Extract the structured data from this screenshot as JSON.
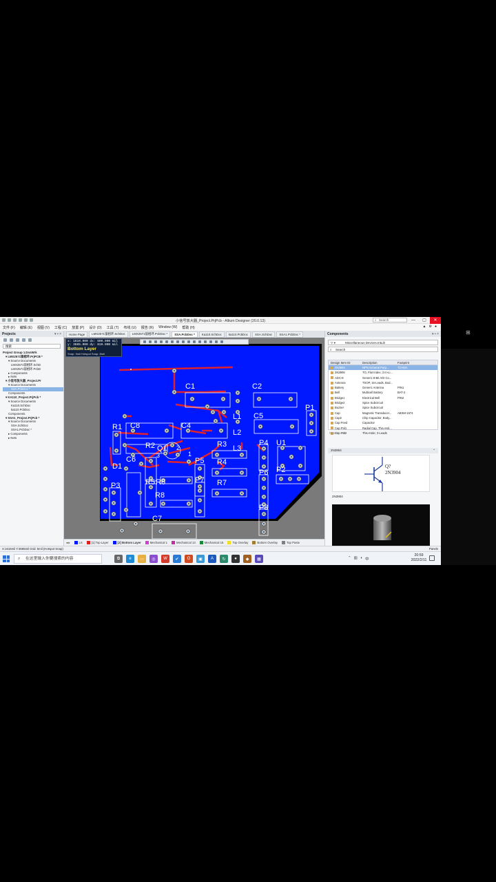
{
  "window": {
    "title": "小信号放大器_Project.PrjPcb - Altium Designer (20.0.13)",
    "search_placeholder": "Search",
    "min": "—",
    "max": "▢",
    "close": "✕"
  },
  "menu": {
    "items": [
      "文件 (F)",
      "编辑 (E)",
      "视图 (V)",
      "工程 (C)",
      "放置 (P)",
      "设计 (D)",
      "工具 (T)",
      "布线 (U)",
      "报告 (R)",
      "Window (W)",
      "帮助 (H)"
    ]
  },
  "projects_panel": {
    "title": "Projects",
    "controls": "▾ ▪ ×",
    "search": "搜索",
    "tree": [
      {
        "text": "Project Group 1.DsnWrk",
        "bold": true,
        "indent": 0
      },
      {
        "text": "▾ LMX2571锁相环.PrjPCB *",
        "bold": true,
        "indent": 1
      },
      {
        "text": "▾ Source Documents",
        "indent": 2
      },
      {
        "text": "LMX2571锁相环.SchD",
        "indent": 3
      },
      {
        "text": "LMX2571锁相环.PcbD",
        "indent": 3
      },
      {
        "text": "▸ Components",
        "indent": 2
      },
      {
        "text": "▸ Nets",
        "indent": 2
      },
      {
        "text": "▾ 小信号放大器_Project.Pr",
        "bold": true,
        "indent": 1
      },
      {
        "text": "▾ Source Documents",
        "indent": 2
      },
      {
        "text": "SSA.PcbDoc *",
        "indent": 3,
        "selected": true
      },
      {
        "text": "Components",
        "indent": 2
      },
      {
        "text": "▾ KA110_Project.PrjPcb *",
        "bold": true,
        "indent": 1
      },
      {
        "text": "▾ Source Documents",
        "indent": 2
      },
      {
        "text": "Ka110.SchDoc",
        "indent": 3
      },
      {
        "text": "ka110.PcbDoc",
        "indent": 3
      },
      {
        "text": "Components",
        "indent": 2
      },
      {
        "text": "▾ SSA1_Project.PrjPcb *",
        "bold": true,
        "indent": 1
      },
      {
        "text": "▾ Source Documents",
        "indent": 2
      },
      {
        "text": "SSA.SchDoc",
        "indent": 3
      },
      {
        "text": "SSA1.PcbDoc *",
        "indent": 3
      },
      {
        "text": "▸ Components",
        "indent": 2
      },
      {
        "text": "▸ Nets",
        "indent": 2
      }
    ]
  },
  "doc_tabs": [
    "Home Page",
    "LMX2571锁相环.SchDoc",
    "LMX2571锁相环.PcbDoc *",
    "SSA.PcbDoc *",
    "Ka110.SchDoc",
    "ka110.PcbDoc",
    "SSA.SchDoc",
    "SSA1.PcbDoc *"
  ],
  "active_tab": 3,
  "hud": {
    "line1": "x: 1610.000  dx:  600.000 mil",
    "line2": "y: 3685.000  dy:  810.000 mil",
    "layer": "Bottom Layer",
    "snap": "Snap: 5mil Hotspot Snap: 8mil"
  },
  "pcb_labels": [
    "C1",
    "C2",
    "L1",
    "C5",
    "P1",
    "R1",
    "C8",
    "C4",
    "L2",
    "L3",
    "U1",
    "R2",
    "Q1",
    "2",
    "3",
    "1",
    "C6",
    "P4",
    "D1",
    "R3",
    "P5",
    "R4",
    "P2",
    "P6",
    "R5",
    "R6",
    "P3",
    "R7",
    "P7",
    "R8",
    "P8",
    "C7"
  ],
  "layer_tabs": [
    {
      "name": "LS",
      "color": "#0018ff"
    },
    {
      "name": "[1] Top Layer",
      "color": "#e02020"
    },
    {
      "name": "[2] Bottom Layer",
      "color": "#0018ff",
      "active": true
    },
    {
      "name": "Mechanical 1",
      "color": "#d040d0"
    },
    {
      "name": "Mechanical 13",
      "color": "#c030a0"
    },
    {
      "name": "Mechanical 15",
      "color": "#1a8a3a"
    },
    {
      "name": "Top Overlay",
      "color": "#f0e020"
    },
    {
      "name": "Bottom Overlay",
      "color": "#a08030"
    },
    {
      "name": "Top Paste",
      "color": "#808080"
    }
  ],
  "components_panel": {
    "title": "Components",
    "library": "Miscellaneous Devices.IntLib",
    "search_placeholder": "Search",
    "columns": [
      "Design Item ID",
      "Description",
      "Footprint"
    ],
    "rows": [
      [
        "2N3904",
        "NPN General Purp...",
        "TO-92A"
      ],
      [
        "2N3906",
        "TO, Flat Index; 3 In-Li...",
        ""
      ],
      [
        "ADC-8",
        "Generic 8-Bit A/D Co...",
        ""
      ],
      [
        "Antenna",
        "TSOP, 16-Leads, Bod...",
        ""
      ],
      [
        "Battery",
        "Generic Antenna",
        "PIN1"
      ],
      [
        "Bell",
        "Multicell Battery",
        "BAT-2"
      ],
      [
        "Bridge1",
        "Electrical Bell",
        "PIN2"
      ],
      [
        "Bridge2",
        "Spice Subcircuit",
        ""
      ],
      [
        "Buzzer",
        "Spice Subcircuit",
        ""
      ],
      [
        "Cap",
        "Magnetic Transducer...",
        "ABSM-1574"
      ],
      [
        "Cap2",
        "Chip Capacitor, Body...",
        ""
      ],
      [
        "Cap Feed",
        "Capacitor",
        ""
      ],
      [
        "Cap Pol1",
        "Radial Cap, Thru-Hol...",
        ""
      ],
      [
        "Cap Pol2",
        "Thru-Hole; 3 Leads",
        ""
      ]
    ],
    "selected_row": 0,
    "results": "Results: 195",
    "selected_name": "2N3904",
    "symbol_designator": "Q?",
    "symbol_value": "2N3904",
    "label_2d": "2N3904"
  },
  "status": {
    "left": "X:1615mil Y:3685mil   Grid: 5mil     (Hotspot Snap)",
    "right": "Panels"
  },
  "taskbar": {
    "search_placeholder": "在这里输入你要搜索的内容",
    "time": "20:59",
    "date": "2022/2/11",
    "ime": "中",
    "apps": [
      {
        "icon": "task-view-icon",
        "color": "#666666",
        "glyph": "⧉"
      },
      {
        "icon": "edge-icon",
        "color": "#1c8ad4",
        "glyph": "e"
      },
      {
        "icon": "folder-icon",
        "color": "#e8b040",
        "glyph": "▭"
      },
      {
        "icon": "app-icon",
        "color": "#8a4fd0",
        "glyph": "◎"
      },
      {
        "icon": "wps-icon",
        "color": "#d23b2b",
        "glyph": "W"
      },
      {
        "icon": "check-icon",
        "color": "#2a7ad8",
        "glyph": "✔"
      },
      {
        "icon": "office-icon",
        "color": "#d04a20",
        "glyph": "O"
      },
      {
        "icon": "photo-icon",
        "color": "#3a9ad8",
        "glyph": "▣"
      },
      {
        "icon": "ai-icon",
        "color": "#1a5abf",
        "glyph": "A"
      },
      {
        "icon": "sync-icon",
        "color": "#2a8a6a",
        "glyph": "↻"
      },
      {
        "icon": "media-icon",
        "color": "#333333",
        "glyph": "●"
      },
      {
        "icon": "altium-icon",
        "color": "#a06020",
        "glyph": "◆"
      },
      {
        "icon": "cad-icon",
        "color": "#5a4ab8",
        "glyph": "▦"
      }
    ]
  },
  "side_glyph": "⊞"
}
